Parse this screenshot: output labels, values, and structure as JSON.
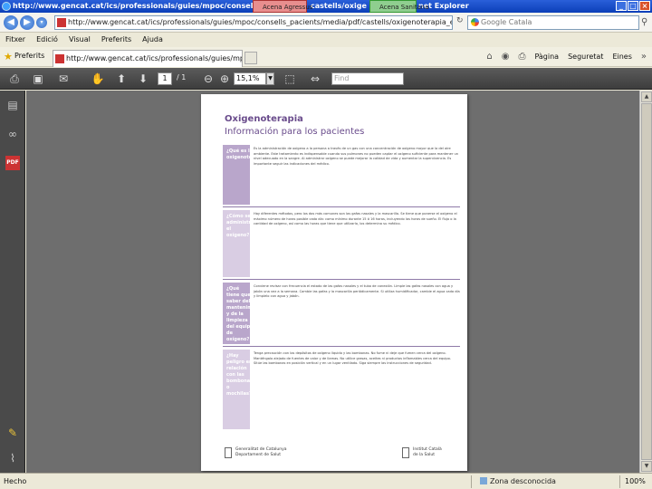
{
  "browser": {
    "window_title": "http://www.gencat.cat/ics/professionals/guies/mpoc/consells_pa",
    "window_title_suffix": "castells/oxige",
    "window_title_end": "net Explorer",
    "overlay_tab_red": "Acena Agressus",
    "overlay_tab_green": "Acena Sanitana",
    "address_url": "http://www.gencat.cat/ics/professionals/guies/mpoc/consells_pacients/media/pdf/castells/oxigenoterapia_es.pdf",
    "search_placeholder": "Google Catala",
    "menu": [
      "Fitxer",
      "Edició",
      "Visual",
      "Preferits",
      "Ajuda"
    ],
    "favorites_label": "Preferits",
    "active_tab": "http://www.gencat.cat/ics/professionals/guies/mpoc/...",
    "command_bar": [
      "Pàgina",
      "Seguretat",
      "Eines"
    ],
    "colors": {
      "titlebar": "#0b3fb8",
      "toolbar": "#4a4a4a",
      "accent": "#6a4c8c"
    }
  },
  "pdf_toolbar": {
    "page_current": "1",
    "page_total": "/ 1",
    "zoom": "15,1%",
    "find_placeholder": "Find"
  },
  "document": {
    "title": "Oxigenoterapia",
    "subtitle": "Información para los pacientes",
    "sections": [
      {
        "label": "¿Qué es la oxigenoterapia?",
        "body": "Es la administración de oxígeno a la persona a través de un gas con una concentración de oxígeno mayor que la del aire ambiente. Este tratamiento es indispensable cuando sus pulmones no pueden captar el oxígeno suficiente para mantener un nivel adecuado en la sangre. Al administrar oxígeno se puede mejorar la calidad de vida y aumentar la supervivencia. Es importante seguir las indicaciones del médico."
      },
      {
        "label": "¿Cómo se administra el oxígeno?",
        "body": "Hay diferentes métodos, pero los dos más comunes son las gafas nasales y la mascarilla. Se tiene que ponerse el oxígeno el máximo número de horas posible cada día: como mínimo durante 15 ó 16 horas, incluyendo las horas de sueño. El flujo o la cantidad de oxígeno, así como las horas que tiene que utilizarlo, los determina su médico."
      },
      {
        "label": "¿Qué tiene que saber del mantenimiento y de la limpieza del equipo de oxígeno?",
        "body": "Conviene revisar con frecuencia el estado de las gafas nasales y el tubo de conexión. Limpie las gafas nasales con agua y jabón una vez a la semana. Cambie las gafas y la mascarilla periódicamente. Si utiliza humidificador, cambie el agua cada día y límpielo con agua y jabón."
      },
      {
        "label": "¿Hay peligro en relación con las bombonas o mochilas?",
        "body": "Tenga precaución con los depósitos de oxígeno líquido y las bombonas. No fume ni deje que fumen cerca del oxígeno. Manténgalo alejado de fuentes de calor y de llamas. No utilice grasas, aceites ni productos inflamables cerca del equipo. Sitúe las bombonas en posición vertical y en un lugar ventilado. Siga siempre las instrucciones de seguridad."
      }
    ],
    "footer_left": "Generalitat de Catalunya\nDepartament de Salut",
    "footer_right": "Institut Català\nde la Salut"
  },
  "status": {
    "left": "Hecho",
    "zone": "Zona desconocida",
    "zoom": "100%"
  }
}
